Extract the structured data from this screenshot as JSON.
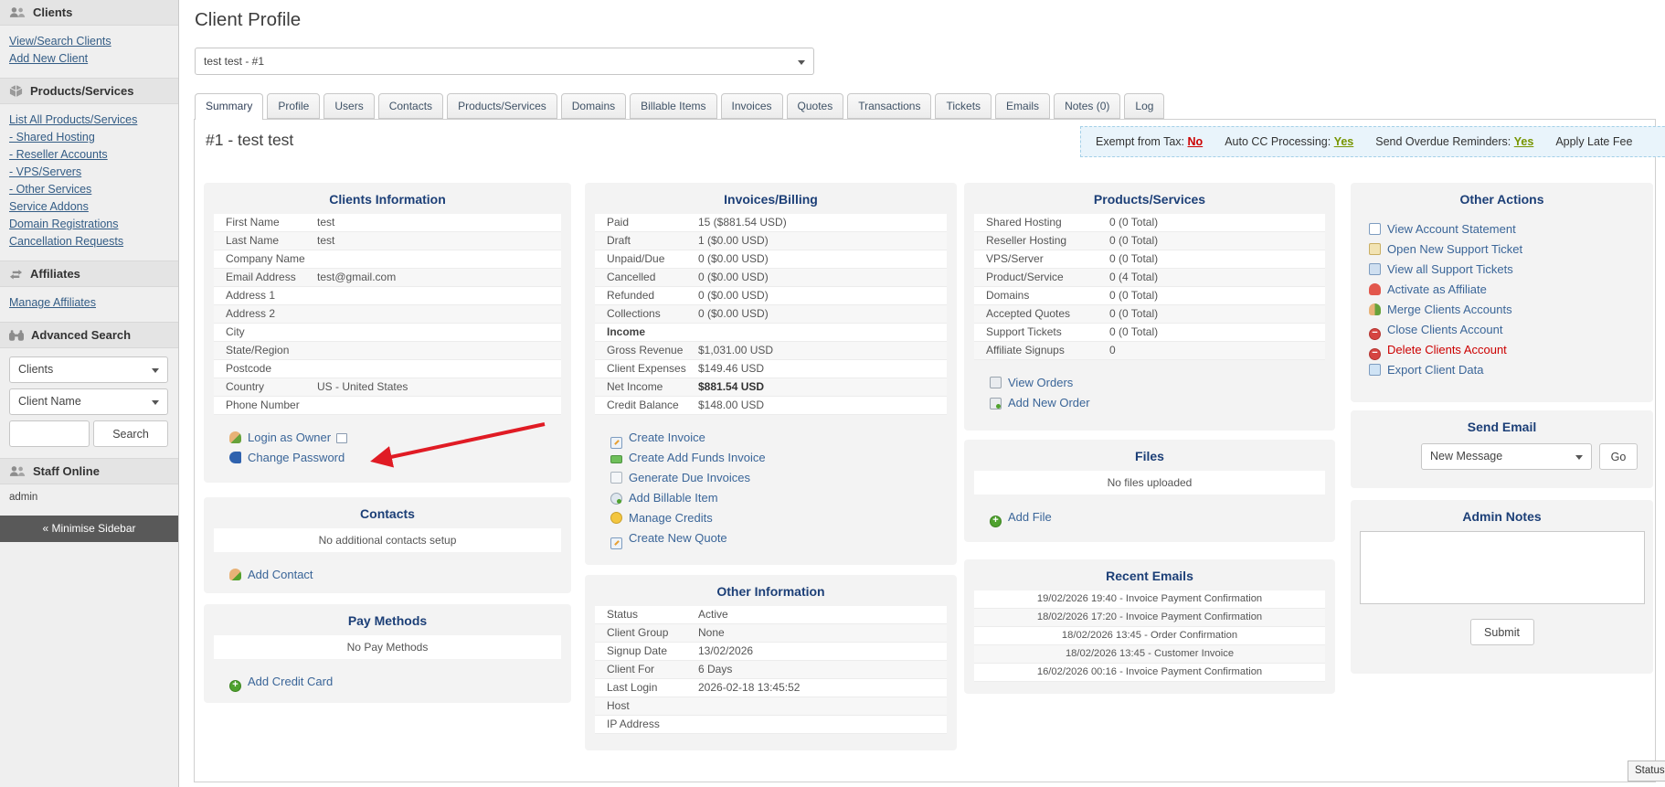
{
  "sidebar": {
    "clients": {
      "title": "Clients",
      "links": [
        "View/Search Clients",
        "Add New Client"
      ]
    },
    "products": {
      "title": "Products/Services",
      "links": [
        "List All Products/Services",
        "- Shared Hosting",
        "- Reseller Accounts",
        "- VPS/Servers",
        "- Other Services",
        "Service Addons",
        "Domain Registrations",
        "Cancellation Requests"
      ]
    },
    "affiliates": {
      "title": "Affiliates",
      "links": [
        "Manage Affiliates"
      ]
    },
    "advanced_search": {
      "title": "Advanced Search",
      "category_select": "Clients",
      "field_select": "Client Name",
      "search_button": "Search"
    },
    "staff_online": {
      "title": "Staff Online",
      "users": [
        "admin"
      ]
    },
    "minimise_label": "« Minimise Sidebar"
  },
  "header": {
    "page_title": "Client Profile",
    "client_selector": "test test - #1"
  },
  "tabs": [
    {
      "label": "Summary",
      "cls": "active"
    },
    {
      "label": "Profile"
    },
    {
      "label": "Users"
    },
    {
      "label": "Contacts"
    },
    {
      "label": "Products/Services"
    },
    {
      "label": "Domains"
    },
    {
      "label": "Billable Items"
    },
    {
      "label": "Invoices"
    },
    {
      "label": "Quotes"
    },
    {
      "label": "Transactions"
    },
    {
      "label": "Tickets"
    },
    {
      "label": "Emails"
    },
    {
      "label": "Notes (0)"
    },
    {
      "label": "Log"
    }
  ],
  "summary": {
    "client_heading": "#1 - test test",
    "flags": [
      {
        "label": "Exempt from Tax:",
        "value": "No",
        "cls": "flag-red"
      },
      {
        "label": "Auto CC Processing:",
        "value": "Yes",
        "cls": "flag-green"
      },
      {
        "label": "Send Overdue Reminders:",
        "value": "Yes",
        "cls": "flag-green"
      },
      {
        "label": "Apply Late Fee",
        "value": ""
      }
    ],
    "status_tooltip": "Status",
    "colors": {
      "flag_no": "#cc0000",
      "flag_yes": "#779500",
      "panel_title": "#1c3f77",
      "link": "#3a6598",
      "danger": "#cc0000",
      "arrow": "#e01b24"
    }
  },
  "panels": {
    "clients_info": {
      "title": "Clients Information",
      "rows": [
        {
          "label": "First Name",
          "value": "test"
        },
        {
          "label": "Last Name",
          "value": "test"
        },
        {
          "label": "Company Name",
          "value": ""
        },
        {
          "label": "Email Address",
          "value": "test@gmail.com"
        },
        {
          "label": "Address 1",
          "value": ""
        },
        {
          "label": "Address 2",
          "value": ""
        },
        {
          "label": "City",
          "value": ""
        },
        {
          "label": "State/Region",
          "value": ""
        },
        {
          "label": "Postcode",
          "value": ""
        },
        {
          "label": "Country",
          "value": "US - United States"
        },
        {
          "label": "Phone Number",
          "value": ""
        }
      ],
      "actions": [
        {
          "label": "Login as Owner",
          "icon": "login-owner",
          "icon2": "window"
        },
        {
          "label": "Change Password",
          "icon": "key"
        }
      ]
    },
    "contacts": {
      "title": "Contacts",
      "empty": "No additional contacts setup",
      "actions": [
        {
          "label": "Add Contact",
          "icon": "add-contact"
        }
      ]
    },
    "pay_methods": {
      "title": "Pay Methods",
      "empty": "No Pay Methods",
      "actions": [
        {
          "label": "Add Credit Card",
          "icon": "add-green"
        }
      ]
    },
    "invoices_billing": {
      "title": "Invoices/Billing",
      "rows": [
        {
          "label": "Paid",
          "value": "15 ($881.54 USD)"
        },
        {
          "label": "Draft",
          "value": "1 ($0.00 USD)"
        },
        {
          "label": "Unpaid/Due",
          "value": "0 ($0.00 USD)"
        },
        {
          "label": "Cancelled",
          "value": "0 ($0.00 USD)"
        },
        {
          "label": "Refunded",
          "value": "0 ($0.00 USD)"
        },
        {
          "label": "Collections",
          "value": "0 ($0.00 USD)"
        },
        {
          "label": "Income",
          "value": "",
          "cls": "bold"
        },
        {
          "label": "Gross Revenue",
          "value": "$1,031.00 USD"
        },
        {
          "label": "Client Expenses",
          "value": "$149.46 USD"
        },
        {
          "label": "Net Income",
          "value": "$881.54 USD",
          "cls": "boldval"
        },
        {
          "label": "Credit Balance",
          "value": "$148.00 USD"
        }
      ],
      "actions": [
        {
          "label": "Create Invoice",
          "icon": "invoice"
        },
        {
          "label": "Create Add Funds Invoice",
          "icon": "funds"
        },
        {
          "label": "Generate Due Invoices",
          "icon": "doc"
        },
        {
          "label": "Add Billable Item",
          "icon": "billable"
        },
        {
          "label": "Manage Credits",
          "icon": "credits"
        },
        {
          "label": "Create New Quote",
          "icon": "invoice"
        }
      ]
    },
    "other_information": {
      "title": "Other Information",
      "rows": [
        {
          "label": "Status",
          "value": "Active"
        },
        {
          "label": "Client Group",
          "value": "None"
        },
        {
          "label": "Signup Date",
          "value": "13/02/2026"
        },
        {
          "label": "Client For",
          "value": "6 Days"
        },
        {
          "label": "Last Login",
          "value": "2026-02-18 13:45:52"
        },
        {
          "label": "Host",
          "value": ""
        },
        {
          "label": "IP Address",
          "value": ""
        }
      ]
    },
    "products_services": {
      "title": "Products/Services",
      "rows": [
        {
          "label": "Shared Hosting",
          "value": "0 (0 Total)"
        },
        {
          "label": "Reseller Hosting",
          "value": "0 (0 Total)"
        },
        {
          "label": "VPS/Server",
          "value": "0 (0 Total)"
        },
        {
          "label": "Product/Service",
          "value": "0 (4 Total)"
        },
        {
          "label": "Domains",
          "value": "0 (0 Total)"
        },
        {
          "label": "Accepted Quotes",
          "value": "0 (0 Total)"
        },
        {
          "label": "Support Tickets",
          "value": "0 (0 Total)"
        },
        {
          "label": "Affiliate Signups",
          "value": "0"
        }
      ],
      "actions": [
        {
          "label": "View Orders",
          "icon": "cart"
        },
        {
          "label": "Add New Order",
          "icon": "cart-add"
        }
      ]
    },
    "files": {
      "title": "Files",
      "empty": "No files uploaded",
      "actions": [
        {
          "label": "Add File",
          "icon": "add-green"
        }
      ]
    },
    "recent_emails": {
      "title": "Recent Emails",
      "items": [
        "19/02/2026 19:40 - Invoice Payment Confirmation",
        "18/02/2026 17:20 - Invoice Payment Confirmation",
        "18/02/2026 13:45 - Order Confirmation",
        "18/02/2026 13:45 - Customer Invoice",
        "16/02/2026 00:16 - Invoice Payment Confirmation"
      ]
    },
    "other_actions": {
      "title": "Other Actions",
      "actions": [
        {
          "label": "View Account Statement",
          "icon": "statement"
        },
        {
          "label": "Open New Support Ticket",
          "icon": "ticket-new"
        },
        {
          "label": "View all Support Tickets",
          "icon": "ticket-view"
        },
        {
          "label": "Activate as Affiliate",
          "icon": "affiliate"
        },
        {
          "label": "Merge Clients Accounts",
          "icon": "merge"
        },
        {
          "label": "Close Clients Account",
          "icon": "close-red"
        },
        {
          "label": "Delete Clients Account",
          "icon": "close-red",
          "cls": "danger"
        },
        {
          "label": "Export Client Data",
          "icon": "export"
        }
      ]
    },
    "send_email": {
      "title": "Send Email",
      "select": "New Message",
      "go_button": "Go"
    },
    "admin_notes": {
      "title": "Admin Notes",
      "submit_button": "Submit"
    }
  }
}
